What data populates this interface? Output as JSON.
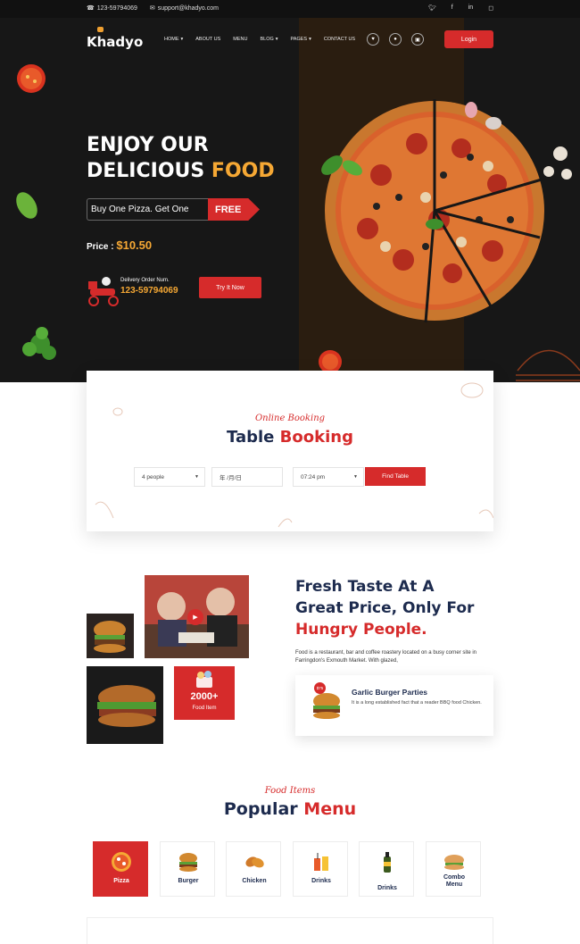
{
  "topbar": {
    "phone": "123-59794069",
    "email": "support@khadyo.com",
    "social": [
      "twitter-icon",
      "facebook-icon",
      "linkedin-icon",
      "instagram-icon"
    ]
  },
  "header": {
    "logo": "Khadyo",
    "nav": [
      {
        "label": "HOME",
        "dropdown": true
      },
      {
        "label": "ABOUT US",
        "dropdown": false
      },
      {
        "label": "MENU",
        "dropdown": false
      },
      {
        "label": "BLOG",
        "dropdown": true
      },
      {
        "label": "PAGES",
        "dropdown": true
      },
      {
        "label": "CONTACT US",
        "dropdown": false
      }
    ],
    "login": "Login"
  },
  "hero": {
    "line1": "ENJOY OUR",
    "line2a": "DELICIOUS",
    "line2b": "FOOD",
    "offer": "Buy One Pizza. Get One",
    "offer_tag": "FREE",
    "price_label": "Price :",
    "price": "$10.50",
    "delivery_label": "Delivery Order Num.",
    "delivery_phone": "123-59794069",
    "cta": "Try It Now"
  },
  "booking": {
    "subtitle": "Online Booking",
    "title_a": "Table",
    "title_b": "Booking",
    "people": "4 people",
    "date": "年 /月/日",
    "time": "07:24 pm",
    "button": "Find Table"
  },
  "about": {
    "title_line1": "Fresh Taste At A",
    "title_line2": "Great Price, Only For",
    "title_line3": "Hungry People.",
    "desc": "Food is a restaurant, bar and coffee roastery located on a busy corner site in Farringdon's Exmouth Market. With glazed,",
    "stat_number": "2000+",
    "stat_label": "Food Item",
    "party_badge": "$75",
    "party_title": "Garlic Burger Parties",
    "party_desc": "It is a long established fact that a reader BBQ food Chicken."
  },
  "menu": {
    "subtitle": "Food Items",
    "title_a": "Popular",
    "title_b": "Menu",
    "categories": [
      "Pizza",
      "Burger",
      "Chicken",
      "Drinks",
      "Drinks",
      "Combo Menu"
    ]
  },
  "colors": {
    "accent": "#d62b2b",
    "navy": "#1d2b4e",
    "yellow": "#f6a834",
    "dark": "#171717"
  }
}
